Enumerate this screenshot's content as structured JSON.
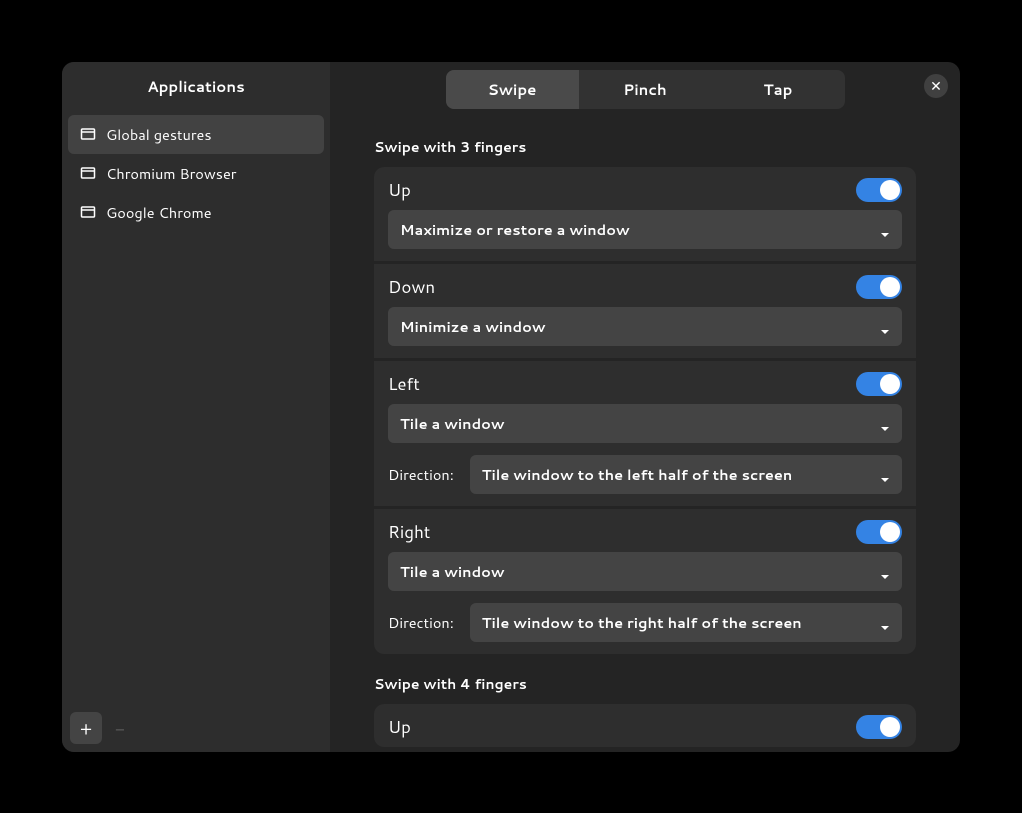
{
  "sidebar": {
    "title": "Applications",
    "items": [
      {
        "label": "Global gestures",
        "selected": true
      },
      {
        "label": "Chromium Browser",
        "selected": false
      },
      {
        "label": "Google Chrome",
        "selected": false
      }
    ],
    "add_label": "+",
    "remove_label": "−"
  },
  "tabs": [
    {
      "label": "Swipe",
      "active": true
    },
    {
      "label": "Pinch",
      "active": false
    },
    {
      "label": "Tap",
      "active": false
    }
  ],
  "close_label": "✕",
  "sections": [
    {
      "title": "Swipe with 3 fingers",
      "gestures": [
        {
          "name": "Up",
          "enabled": true,
          "action": "Maximize or restore a window"
        },
        {
          "name": "Down",
          "enabled": true,
          "action": "Minimize a window"
        },
        {
          "name": "Left",
          "enabled": true,
          "action": "Tile a window",
          "sub_label": "Direction:",
          "sub_value": "Tile window to the left half of the screen"
        },
        {
          "name": "Right",
          "enabled": true,
          "action": "Tile a window",
          "sub_label": "Direction:",
          "sub_value": "Tile window to the right half of the screen"
        }
      ]
    },
    {
      "title": "Swipe with 4 fingers",
      "gestures": [
        {
          "name": "Up",
          "enabled": true
        }
      ]
    }
  ]
}
